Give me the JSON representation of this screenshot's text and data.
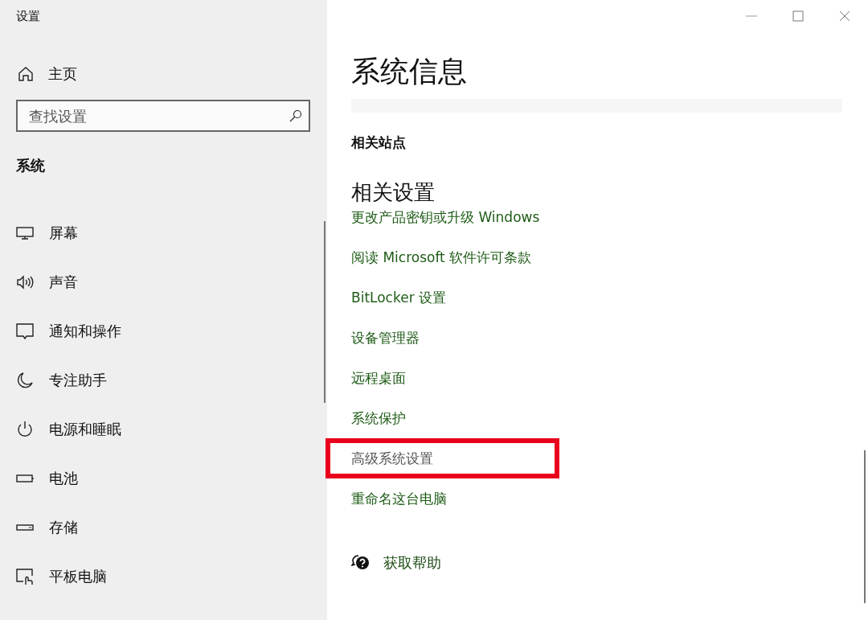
{
  "sidebar": {
    "app_title": "设置",
    "home": "主页",
    "search": {
      "placeholder": "查找设置"
    },
    "section": "系统",
    "items": [
      {
        "label": "屏幕"
      },
      {
        "label": "声音"
      },
      {
        "label": "通知和操作"
      },
      {
        "label": "专注助手"
      },
      {
        "label": "电源和睡眠"
      },
      {
        "label": "电池"
      },
      {
        "label": "存储"
      },
      {
        "label": "平板电脑"
      }
    ]
  },
  "content": {
    "title": "系统信息",
    "related_sites": "相关站点",
    "related_settings": "相关设置",
    "links": [
      {
        "label": "更改产品密钥或升级 Windows",
        "highlighted": false
      },
      {
        "label": "阅读 Microsoft 软件许可条款",
        "highlighted": false
      },
      {
        "label": "BitLocker 设置",
        "highlighted": false
      },
      {
        "label": "设备管理器",
        "highlighted": false
      },
      {
        "label": "远程桌面",
        "highlighted": false
      },
      {
        "label": "系统保护",
        "highlighted": false
      },
      {
        "label": "高级系统设置",
        "highlighted": true
      },
      {
        "label": "重命名这台电脑",
        "highlighted": false
      }
    ],
    "help": "获取帮助"
  }
}
